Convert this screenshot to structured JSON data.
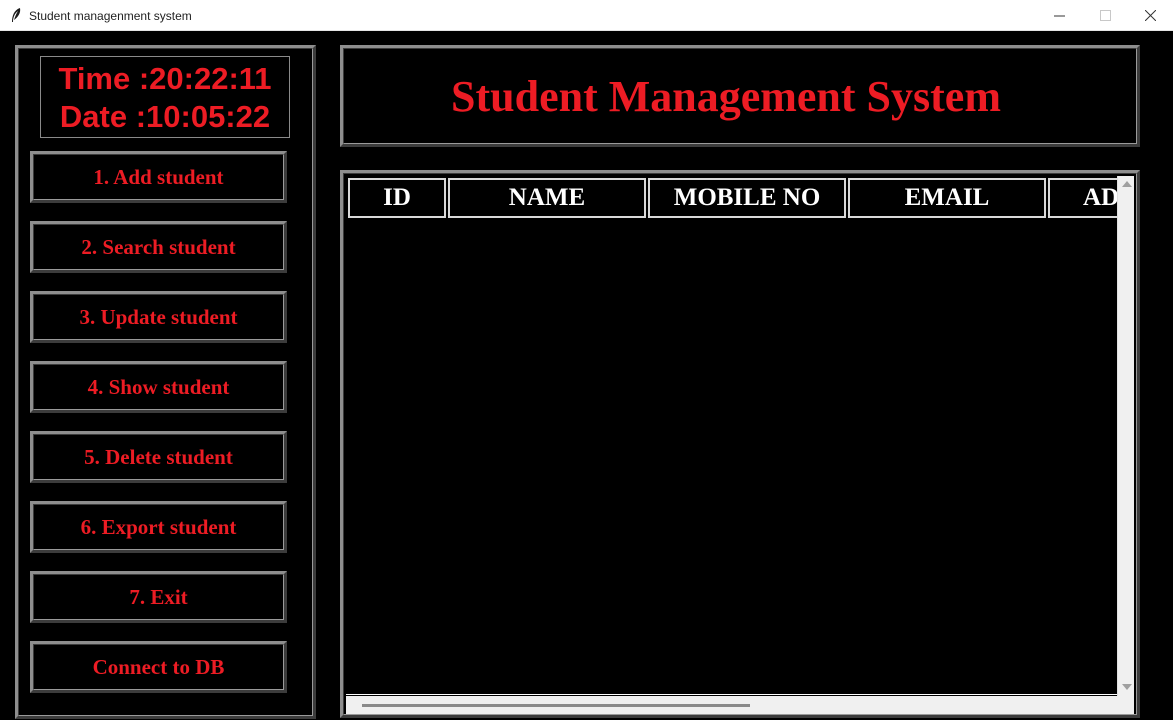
{
  "window": {
    "title": "Student managenment system",
    "app_icon": "feather-icon"
  },
  "clock": {
    "time": "Time :20:22:11",
    "date": "Date :10:05:22"
  },
  "menu": [
    {
      "label": "1. Add student"
    },
    {
      "label": "2. Search student"
    },
    {
      "label": "3. Update student"
    },
    {
      "label": "4. Show student"
    },
    {
      "label": "5. Delete student"
    },
    {
      "label": "6. Export student"
    },
    {
      "label": "7. Exit"
    },
    {
      "label": "Connect to DB"
    }
  ],
  "header": {
    "title": "Student Management System"
  },
  "table": {
    "columns": [
      "ID",
      "NAME",
      "MOBILE NO",
      "EMAIL",
      "AD"
    ],
    "rows": []
  },
  "colors": {
    "accent": "#ed1c24",
    "background": "#000000",
    "header_text": "#ffffff"
  }
}
